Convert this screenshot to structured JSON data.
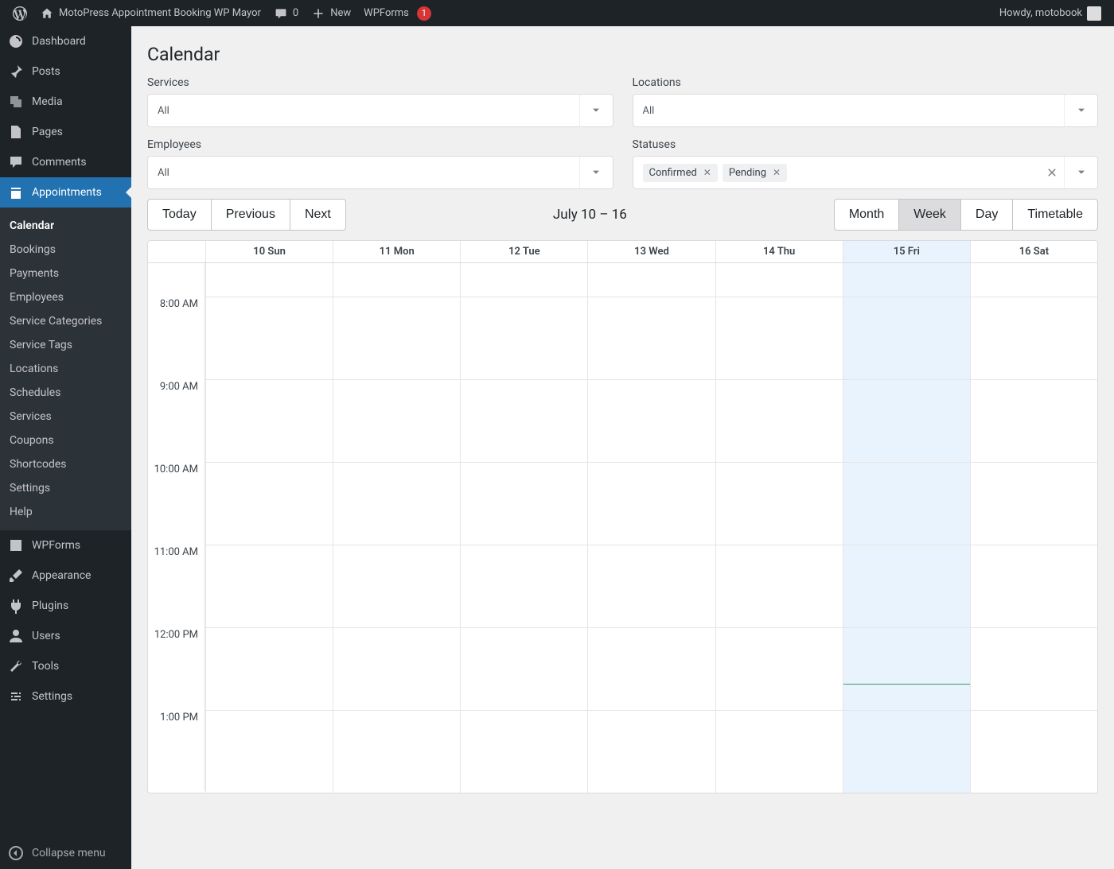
{
  "adminbar": {
    "site_title": "MotoPress Appointment Booking WP Mayor",
    "comments_count": "0",
    "new_label": "New",
    "wpforms_label": "WPForms",
    "wpforms_badge": "1",
    "howdy": "Howdy, motobook"
  },
  "sidebar": {
    "dashboard": "Dashboard",
    "posts": "Posts",
    "media": "Media",
    "pages": "Pages",
    "comments": "Comments",
    "appointments": "Appointments",
    "wpforms": "WPForms",
    "appearance": "Appearance",
    "plugins": "Plugins",
    "users": "Users",
    "tools": "Tools",
    "settings": "Settings",
    "collapse": "Collapse menu",
    "sub": {
      "calendar": "Calendar",
      "bookings": "Bookings",
      "payments": "Payments",
      "employees": "Employees",
      "service_categories": "Service Categories",
      "service_tags": "Service Tags",
      "locations": "Locations",
      "schedules": "Schedules",
      "services": "Services",
      "coupons": "Coupons",
      "shortcodes": "Shortcodes",
      "settings": "Settings",
      "help": "Help"
    }
  },
  "page": {
    "title": "Calendar"
  },
  "filters": {
    "services_label": "Services",
    "services_value": "All",
    "locations_label": "Locations",
    "locations_value": "All",
    "employees_label": "Employees",
    "employees_value": "All",
    "statuses_label": "Statuses",
    "statuses_tags": [
      "Confirmed",
      "Pending"
    ]
  },
  "toolbar": {
    "today": "Today",
    "previous": "Previous",
    "next": "Next",
    "range": "July 10 – 16",
    "views": {
      "month": "Month",
      "week": "Week",
      "day": "Day",
      "timetable": "Timetable"
    },
    "active_view": "week"
  },
  "calendar": {
    "days": [
      "10 Sun",
      "11 Mon",
      "12 Tue",
      "13 Wed",
      "14 Thu",
      "15 Fri",
      "16 Sat"
    ],
    "today_index": 5,
    "time_slots": [
      "8:00 AM",
      "9:00 AM",
      "10:00 AM",
      "11:00 AM",
      "12:00 PM",
      "1:00 PM"
    ]
  }
}
